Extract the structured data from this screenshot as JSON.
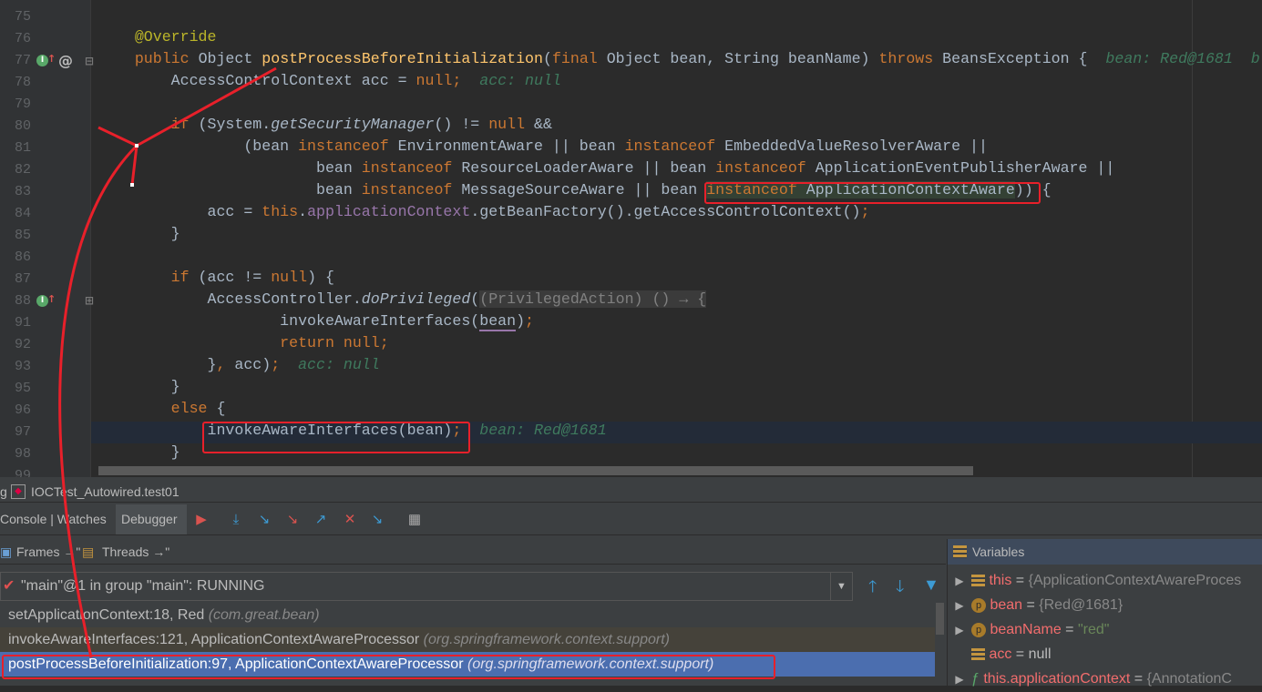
{
  "editor": {
    "lines": [
      {
        "n": "75",
        "t": []
      },
      {
        "n": "76",
        "t": [
          [
            "    @Override",
            "an"
          ]
        ]
      },
      {
        "n": "77",
        "t": [
          [
            "    "
          ],
          [
            "public ",
            "kw"
          ],
          [
            "Object "
          ],
          [
            "postProcessBeforeInitialization",
            "fn"
          ],
          [
            "("
          ],
          [
            "final ",
            "kw"
          ],
          [
            "Object bean, String beanName) "
          ],
          [
            "throws ",
            "kw"
          ],
          [
            "BeansException {  "
          ],
          [
            "bean: Red@1681  b",
            "hint"
          ]
        ]
      },
      {
        "n": "78",
        "t": [
          [
            "        AccessControlContext acc = "
          ],
          [
            "null",
            "kw"
          ],
          [
            ";  ",
            "kw"
          ],
          [
            "acc: null",
            "hint"
          ]
        ]
      },
      {
        "n": "79",
        "t": []
      },
      {
        "n": "80",
        "t": [
          [
            "        "
          ],
          [
            "if ",
            "kw"
          ],
          [
            "(System."
          ],
          [
            "getSecurityManager",
            "it"
          ],
          [
            "() != "
          ],
          [
            "null ",
            "kw"
          ],
          [
            "&&"
          ]
        ]
      },
      {
        "n": "81",
        "t": [
          [
            "                (bean "
          ],
          [
            "instanceof ",
            "kw"
          ],
          [
            "EnvironmentAware || bean "
          ],
          [
            "instanceof ",
            "kw"
          ],
          [
            "EmbeddedValueResolverAware ||"
          ]
        ]
      },
      {
        "n": "82",
        "t": [
          [
            "                        bean "
          ],
          [
            "instanceof ",
            "kw"
          ],
          [
            "ResourceLoaderAware || bean "
          ],
          [
            "instanceof ",
            "kw"
          ],
          [
            "ApplicationEventPublisherAware ||"
          ]
        ]
      },
      {
        "n": "83",
        "t": [
          [
            "                        bean "
          ],
          [
            "instanceof ",
            "kw"
          ],
          [
            "MessageSourceAware || bean "
          ],
          [
            "instanceof ",
            "kw hl"
          ],
          [
            "ApplicationContextAware",
            "hl"
          ],
          [
            ")) {"
          ]
        ]
      },
      {
        "n": "84",
        "t": [
          [
            "            acc = "
          ],
          [
            "this",
            "kw"
          ],
          [
            "."
          ],
          [
            "applicationContext",
            "fld"
          ],
          [
            ".getBeanFactory().getAccessControlContext()"
          ],
          [
            ";",
            "kw"
          ]
        ]
      },
      {
        "n": "85",
        "t": [
          [
            "        }"
          ]
        ]
      },
      {
        "n": "86",
        "t": []
      },
      {
        "n": "87",
        "t": [
          [
            "        "
          ],
          [
            "if ",
            "kw"
          ],
          [
            "(acc != "
          ],
          [
            "null",
            "kw"
          ],
          [
            ") {"
          ]
        ]
      },
      {
        "n": "88",
        "t": [
          [
            "            AccessController."
          ],
          [
            "doPrivileged",
            "it"
          ],
          [
            "("
          ],
          [
            "(PrivilegedAction) () → {",
            "fold"
          ]
        ]
      },
      {
        "n": "91",
        "t": [
          [
            "                    invokeAwareInterfaces("
          ],
          [
            "bean",
            "ul"
          ],
          [
            ")"
          ],
          [
            ";",
            "kw"
          ]
        ]
      },
      {
        "n": "92",
        "t": [
          [
            "                    "
          ],
          [
            "return null;",
            "kw"
          ]
        ]
      },
      {
        "n": "93",
        "t": [
          [
            "            }"
          ],
          [
            ", ",
            "kw"
          ],
          [
            "acc)"
          ],
          [
            ";  ",
            "kw"
          ],
          [
            "acc: null",
            "hint"
          ]
        ]
      },
      {
        "n": "95",
        "t": [
          [
            "        }"
          ]
        ]
      },
      {
        "n": "96",
        "t": [
          [
            "        "
          ],
          [
            "else ",
            "kw"
          ],
          [
            "{"
          ]
        ]
      },
      {
        "n": "97",
        "t": [
          [
            "            invokeAwareInterfaces(bean)"
          ],
          [
            ";",
            "kw"
          ],
          [
            "  "
          ],
          [
            "bean: Red@1681",
            "hint"
          ]
        ]
      },
      {
        "n": "98",
        "t": [
          [
            "        }"
          ]
        ]
      },
      {
        "n": "99",
        "t": []
      }
    ],
    "current_line": "97"
  },
  "panel": {
    "title_prefix": "g",
    "run_config": "IOCTest_Autowired.test01",
    "tabs": {
      "console_watches": "Console | Watches",
      "debugger": "Debugger"
    },
    "frames_tab": "Frames →\"",
    "threads_tab": "Threads →\"",
    "thread": "\"main\"@1 in group \"main\": RUNNING",
    "frames": [
      {
        "method": "setApplicationContext:18, Red",
        "pkg": "(com.great.bean)",
        "state": "normal"
      },
      {
        "method": "invokeAwareInterfaces:121, ApplicationContextAwareProcessor",
        "pkg": "(org.springframework.context.support)",
        "state": "library"
      },
      {
        "method": "postProcessBeforeInitialization:97, ApplicationContextAwareProcessor",
        "pkg": "(org.springframework.context.support)",
        "state": "selected"
      }
    ],
    "variables": {
      "title": "Variables",
      "items": [
        {
          "name": "this",
          "eq": " = ",
          "value": "{ApplicationContextAwareProces",
          "icon": "field-icon"
        },
        {
          "name": "bean",
          "eq": " = ",
          "value": "{Red@1681}",
          "icon": "parameter-icon"
        },
        {
          "name": "beanName",
          "eq": " = ",
          "value": "\"red\"",
          "icon": "parameter-icon"
        },
        {
          "name": "acc",
          "eq": " = ",
          "value": "null",
          "icon": "field-icon"
        },
        {
          "name": "this.applicationContext",
          "eq": " = ",
          "value": "{AnnotationC",
          "icon": "lambda-field-icon"
        }
      ]
    }
  },
  "colors": {
    "annotation": "#e8202a",
    "selected_frame": "#4b6eaf",
    "library_frame": "#45423a"
  }
}
